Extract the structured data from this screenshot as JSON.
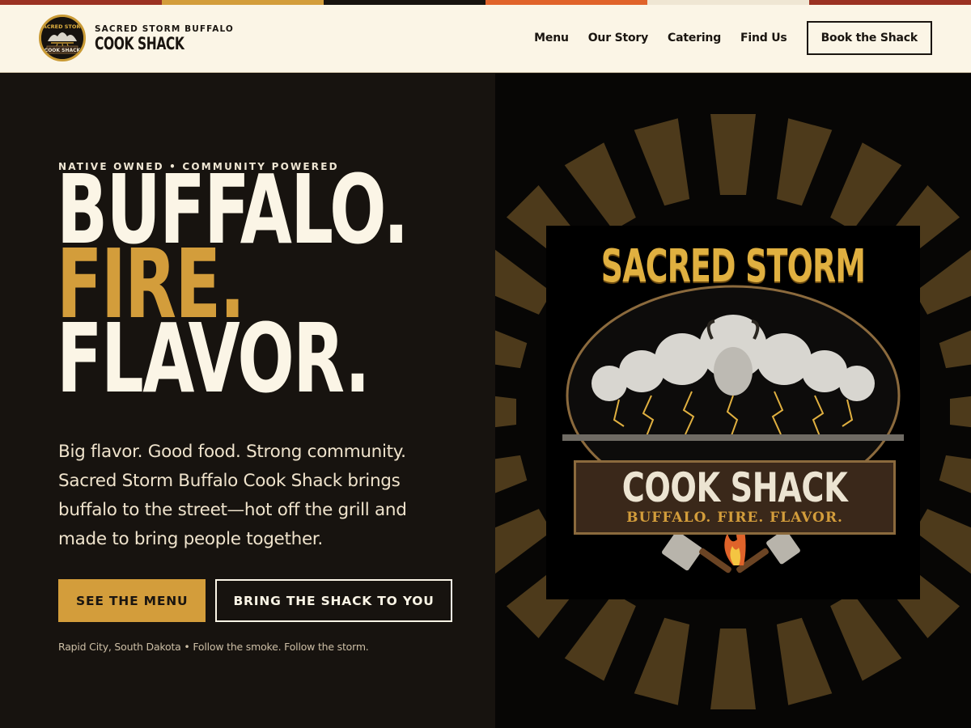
{
  "colors": {
    "stripe": [
      "#9b3222",
      "#d39d3b",
      "#17130f",
      "#e0632a",
      "#efe6d3",
      "#9b3222"
    ],
    "accent": "#d39d3b",
    "cream": "#fbf5e6",
    "dark": "#17130f"
  },
  "header": {
    "brand_small": "SACRED STORM BUFFALO",
    "brand_big": "COOK SHACK",
    "badge_top": "SACRED STORM",
    "badge_bottom": "COOK SHACK",
    "nav": [
      "Menu",
      "Our Story",
      "Catering",
      "Find Us"
    ],
    "book_label": "Book the Shack"
  },
  "hero": {
    "kicker": "NATIVE OWNED • COMMUNITY POWERED",
    "headline": [
      "BUFFALO.",
      "FIRE.",
      "FLAVOR."
    ],
    "description": "Big flavor. Good food. Strong community. Sacred Storm Buffalo Cook Shack brings buffalo to the street—hot off the grill and made to bring people together.",
    "primary_cta": "SEE THE MENU",
    "secondary_cta": "BRING THE SHACK TO YOU",
    "footnote": "Rapid City, South Dakota • Follow the smoke. Follow the storm."
  },
  "logo": {
    "title": "SACRED STORM",
    "plate_main": "COOK SHACK",
    "plate_sub": "BUFFALO. FIRE. FLAVOR."
  },
  "icons": [
    "buffalo-herd-icon",
    "lightning-icon",
    "cleaver-icon",
    "spatula-icon",
    "flame-icon"
  ]
}
